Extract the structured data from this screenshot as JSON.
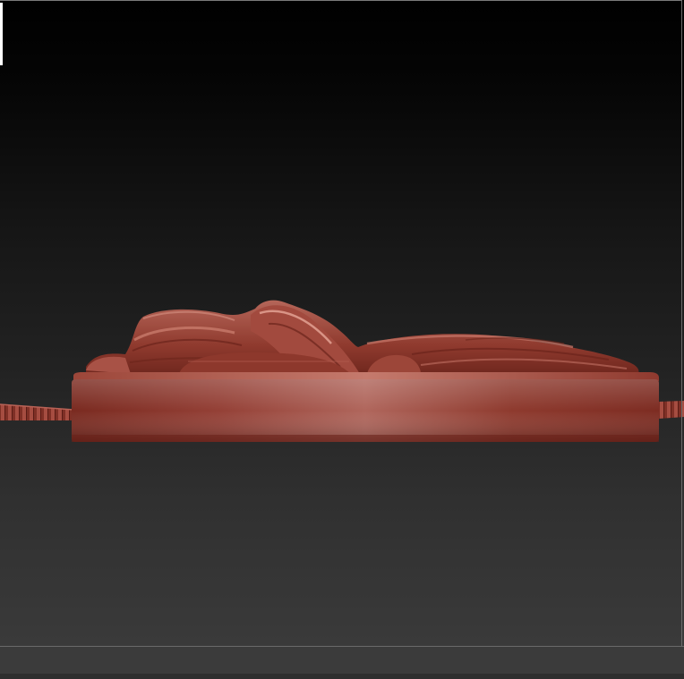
{
  "viewport": {
    "background_top": "#000000",
    "background_bottom": "#3a3a3a"
  },
  "model": {
    "material_color": "#9a3c30",
    "highlight_color": "#c77a6e",
    "shadow_color": "#5e1f18",
    "icon": "sculpted-relief-medallion"
  },
  "status_bar": {
    "color": "#3b3b3b"
  }
}
